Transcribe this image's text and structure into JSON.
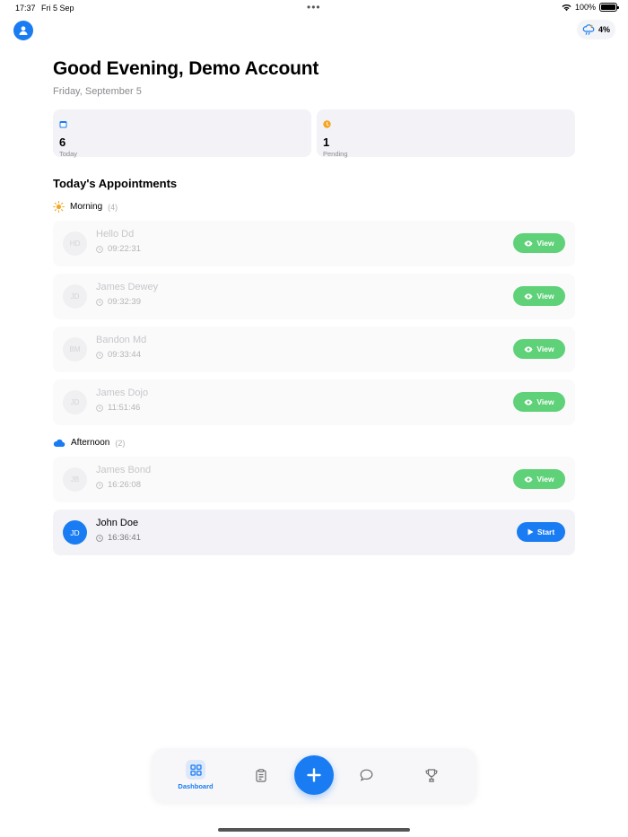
{
  "status_bar": {
    "time": "17:37",
    "date": "Fri 5 Sep",
    "battery": "100%"
  },
  "header": {
    "weather_value": "4%"
  },
  "greeting": {
    "title": "Good Evening, Demo Account",
    "date": "Friday, September 5"
  },
  "stats": [
    {
      "value": "6",
      "label": "Today",
      "accent": "#1a7cf2"
    },
    {
      "value": "1",
      "label": "Pending",
      "accent": "#f5a623"
    }
  ],
  "appointments_section": {
    "title": "Today's Appointments",
    "groups": [
      {
        "name": "Morning",
        "count": "(4)",
        "items": [
          {
            "initials": "HD",
            "name": "Hello Dd",
            "time": "09:22:31",
            "action": "View"
          },
          {
            "initials": "JD",
            "name": "James Dewey",
            "time": "09:32:39",
            "action": "View"
          },
          {
            "initials": "BM",
            "name": "Bandon Md",
            "time": "09:33:44",
            "action": "View"
          },
          {
            "initials": "JD",
            "name": "James Dojo",
            "time": "11:51:46",
            "action": "View"
          }
        ]
      },
      {
        "name": "Afternoon",
        "count": "(2)",
        "items": [
          {
            "initials": "JB",
            "name": "James Bond",
            "time": "16:26:08",
            "action": "View"
          },
          {
            "initials": "JD",
            "name": "John Doe",
            "time": "16:36:41",
            "action": "Start"
          }
        ]
      }
    ]
  },
  "tabbar": {
    "dashboard_label": "Dashboard"
  },
  "colors": {
    "accent": "#1a7cf2",
    "success": "#5fd178",
    "card_bg": "#f2f2f7"
  }
}
